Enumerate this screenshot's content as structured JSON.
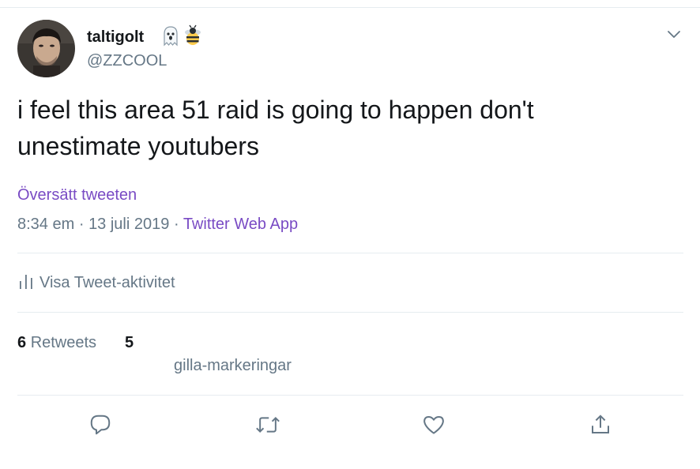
{
  "author": {
    "display_name": "taltigolt",
    "handle": "@ZZCOOL",
    "emojis": [
      "ghost-emoji",
      "bee-emoji"
    ]
  },
  "tweet": {
    "text": "i feel this area 51 raid is going to happen don't\nunestimate youtubers",
    "translate_label": "Översätt tweeten",
    "time": "8:34 em",
    "date": "13 juli 2019",
    "separator": "·",
    "source": "Twitter Web App"
  },
  "activity": {
    "label": "Visa Tweet-aktivitet",
    "icon": "bar-chart-icon"
  },
  "stats": {
    "retweets_count": "6",
    "retweets_label": "Retweets",
    "likes_count": "5",
    "likes_label": "gilla-markeringar"
  },
  "actions": [
    {
      "name": "reply",
      "icon": "reply-icon"
    },
    {
      "name": "retweet",
      "icon": "retweet-icon"
    },
    {
      "name": "like",
      "icon": "heart-icon"
    },
    {
      "name": "share",
      "icon": "share-icon"
    }
  ],
  "colors": {
    "link": "#794bc4",
    "secondary_text": "#657786",
    "primary_text": "#14171a",
    "divider": "#e6ecf0"
  }
}
